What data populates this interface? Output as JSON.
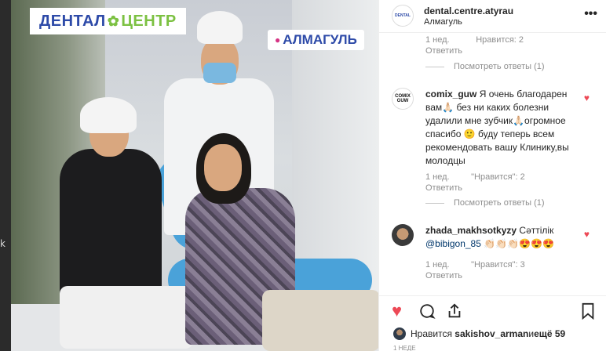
{
  "left_edge_text": "k",
  "photo": {
    "brand_part1": "ДЕНТАЛ",
    "brand_part2": "ЦЕНТР",
    "location_badge": "АЛМАГУЛЬ"
  },
  "post": {
    "account": "dental.centre.atyrau",
    "location": "Алмагуль",
    "more_icon": "more-dots-icon"
  },
  "comments": {
    "top_meta": {
      "age": "1 нед.",
      "likes": "Нравится: 2",
      "reply": "Ответить"
    },
    "top_view_replies": "Посмотреть ответы (1)",
    "items": [
      {
        "username": "comix_guw",
        "text": "Я очень благодарен вам🙏🏻 без ни каких болезни удалили мне зубчик🙏🏻огромное спасибо 🙂 буду теперь всем рекомендовать вашу Клинику,вы молодцы",
        "age": "1 нед.",
        "likes": "\"Нравится\": 2",
        "reply": "Ответить",
        "view_replies": "Посмотреть ответы (1)",
        "liked": true
      },
      {
        "username": "zhada_makhsotkyzy",
        "text": " Сәттілік ",
        "mention": "@bibigon_85",
        "emoji": " 👏🏻👏🏻👏🏻😍😍😍",
        "age": "1 нед.",
        "likes": "\"Нравится\": 3",
        "reply": "Ответить",
        "liked": true
      }
    ]
  },
  "actions": {
    "like_icon": "heart-filled-icon",
    "comment_icon": "comment-bubble-icon",
    "share_icon": "share-icon",
    "save_icon": "bookmark-icon",
    "liked_by_prefix": "Нравится",
    "liked_by_user": "sakishov_arman",
    "liked_by_suffix_pre": " и ",
    "liked_by_others": "ещё 59"
  },
  "time_ago": "1 НЕДЕ"
}
